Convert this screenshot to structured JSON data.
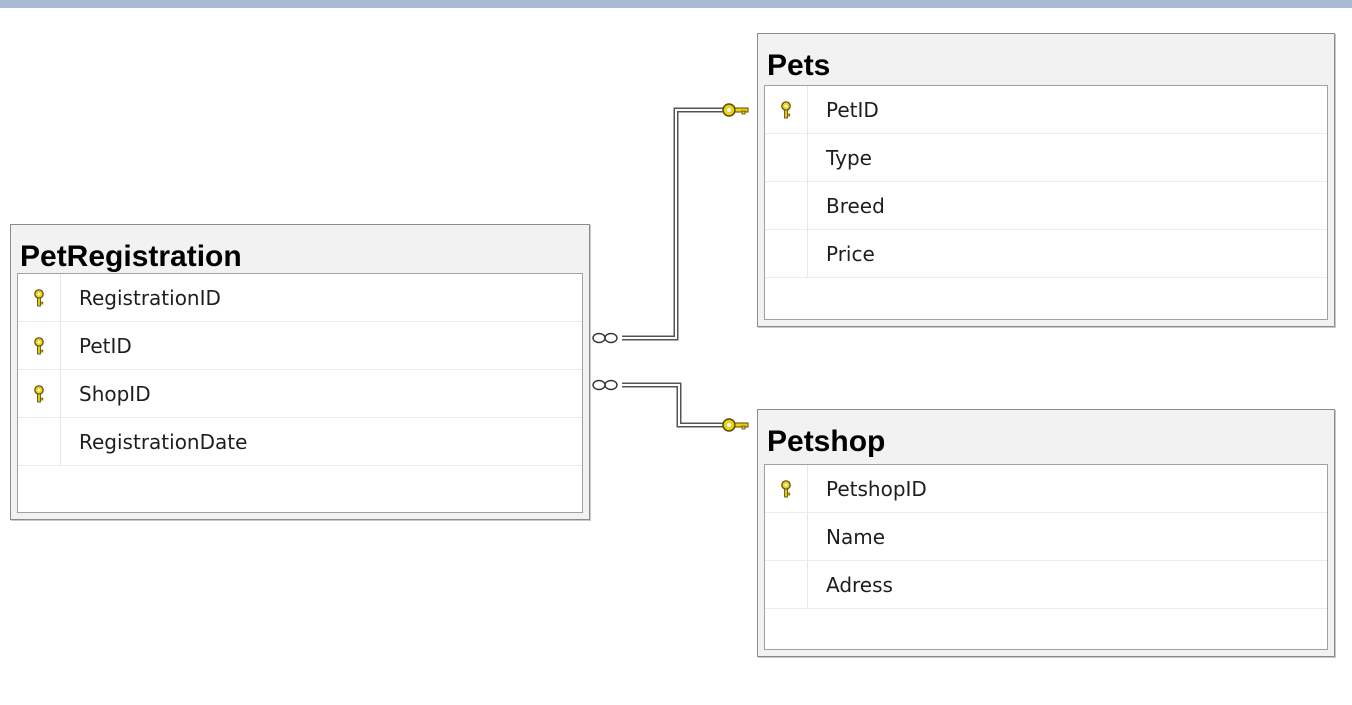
{
  "tables": [
    {
      "id": "petregistration",
      "name": "PetRegistration",
      "columns": [
        {
          "name": "RegistrationID",
          "primary_key": true
        },
        {
          "name": "PetID",
          "primary_key": true
        },
        {
          "name": "ShopID",
          "primary_key": true
        },
        {
          "name": "RegistrationDate",
          "primary_key": false
        }
      ]
    },
    {
      "id": "pets",
      "name": "Pets",
      "columns": [
        {
          "name": "PetID",
          "primary_key": true
        },
        {
          "name": "Type",
          "primary_key": false
        },
        {
          "name": "Breed",
          "primary_key": false
        },
        {
          "name": "Price",
          "primary_key": false
        }
      ]
    },
    {
      "id": "petshop",
      "name": "Petshop",
      "columns": [
        {
          "name": "PetshopID",
          "primary_key": true
        },
        {
          "name": "Name",
          "primary_key": false
        },
        {
          "name": "Adress",
          "primary_key": false
        }
      ]
    }
  ],
  "relationships": [
    {
      "from": "PetRegistration",
      "to": "Pets",
      "from_end": "many",
      "to_end": "one"
    },
    {
      "from": "PetRegistration",
      "to": "Petshop",
      "from_end": "many",
      "to_end": "one"
    }
  ],
  "colors": {
    "key_icon": "#e8d21a",
    "key_outline": "#5a4a00",
    "connector": "#555555",
    "table_header": "#f2f2f2",
    "top_bar": "#a7bad0"
  }
}
